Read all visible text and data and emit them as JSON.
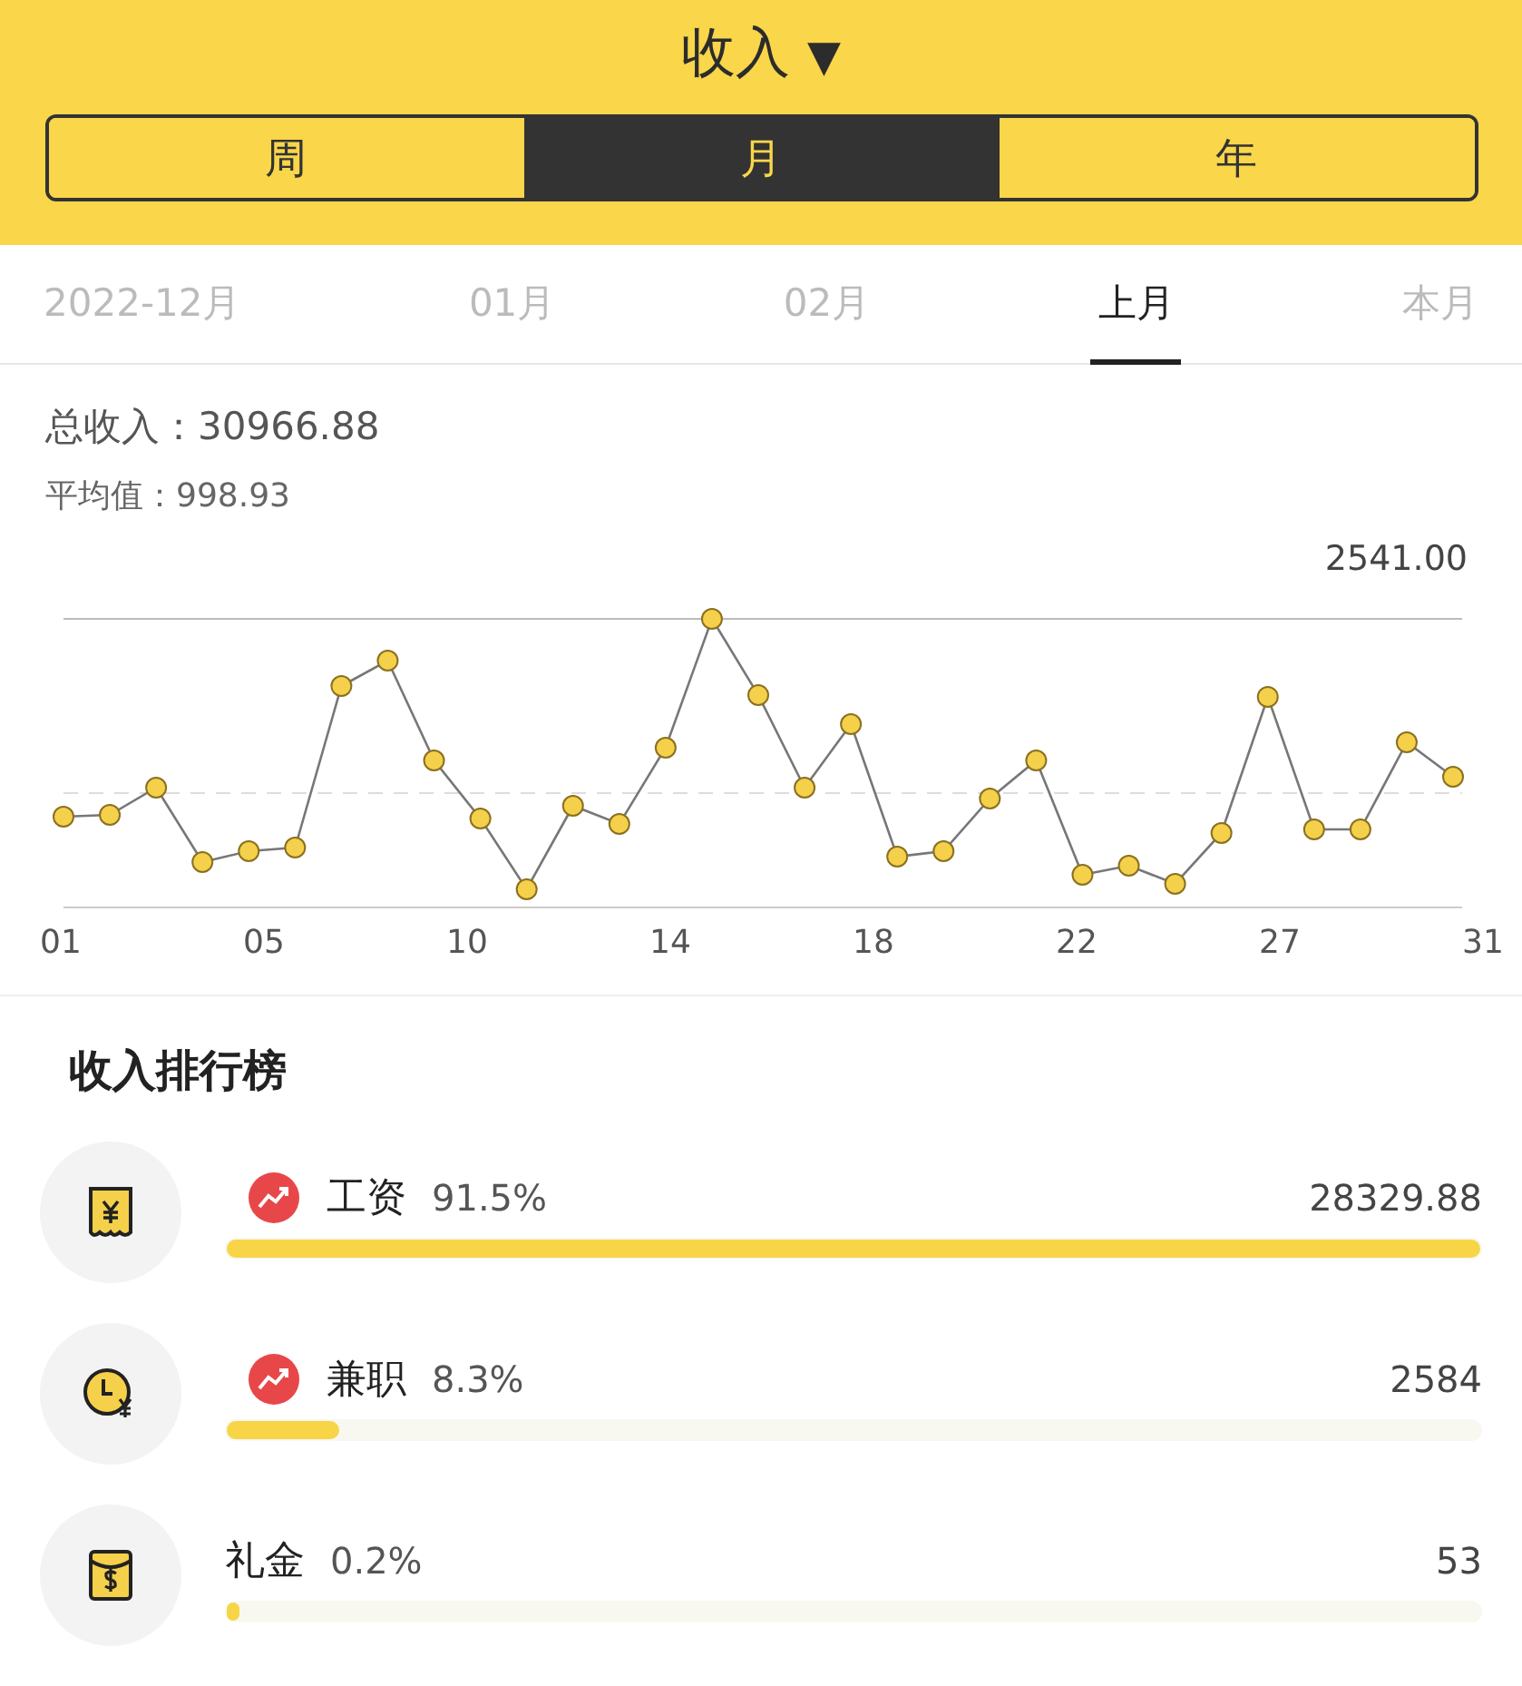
{
  "header": {
    "title": "收入",
    "caret": "▼"
  },
  "periods": [
    {
      "label": "周",
      "selected": false
    },
    {
      "label": "月",
      "selected": true
    },
    {
      "label": "年",
      "selected": false
    }
  ],
  "months": [
    {
      "label": "2022-12月",
      "selected": false
    },
    {
      "label": "01月",
      "selected": false
    },
    {
      "label": "02月",
      "selected": false
    },
    {
      "label": "上月",
      "selected": true
    },
    {
      "label": "本月",
      "selected": false
    }
  ],
  "summary": {
    "total_label": "总收入：",
    "total": "30966.88",
    "average_label": "平均值：",
    "average": "998.93"
  },
  "chart": {
    "max_label": "2541.00",
    "x_labels": [
      "01",
      "05",
      "10",
      "14",
      "18",
      "22",
      "27",
      "31"
    ]
  },
  "ranking": {
    "title": "收入排行榜",
    "items": [
      {
        "kind": "receipt",
        "name": "工资",
        "percent": "91.5%",
        "amount": "28329.88",
        "trending": true,
        "level": 1
      },
      {
        "kind": "clock",
        "name": "兼职",
        "percent": "8.3%",
        "amount": "2584",
        "trending": true,
        "level": 0.09
      },
      {
        "kind": "envelope",
        "name": "礼金",
        "percent": "0.2%",
        "amount": "53",
        "trending": false,
        "level": 0.01
      }
    ]
  }
}
